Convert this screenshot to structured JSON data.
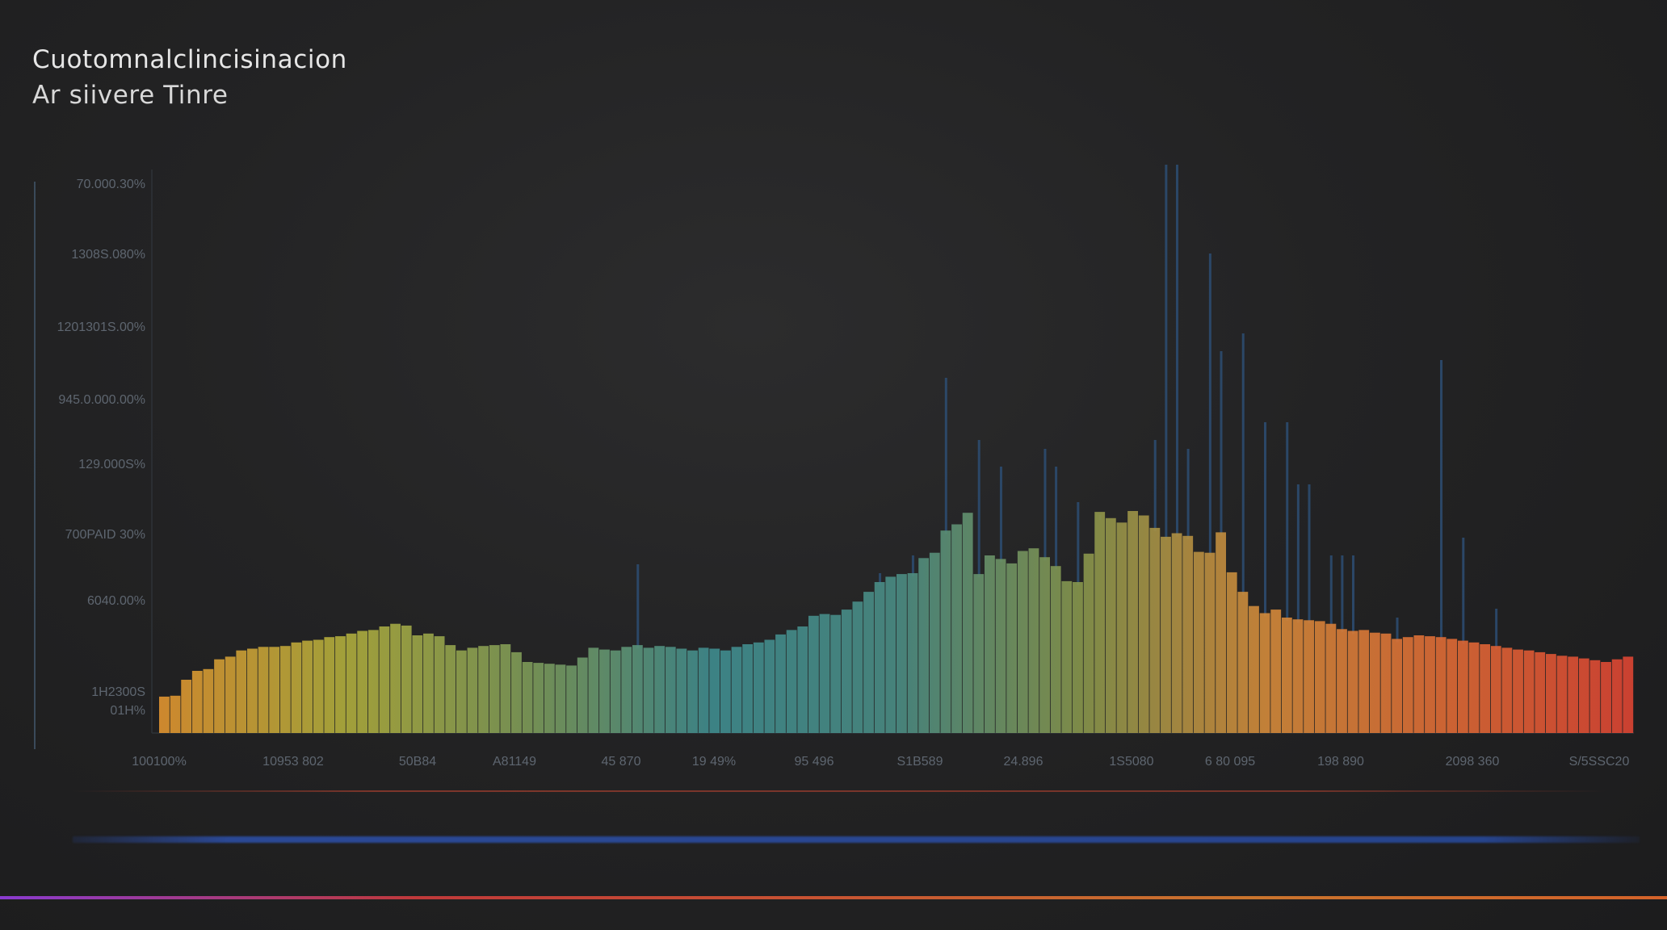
{
  "chart_data": {
    "type": "bar",
    "title": "Cuotomnalclincisinacion",
    "subtitle": "Ar siivere Tinre",
    "xlabel": "",
    "ylabel": "",
    "y_ticks": [
      "70.000.30%",
      "1308S.080%",
      "1201301S.00%",
      "945.0.000.00%",
      "129.000S%",
      "700PAID 30%",
      "6040.00%",
      "1H2300S",
      "01H%"
    ],
    "x_ticks": [
      "100100%",
      "10953 802",
      "50B84",
      "A81149",
      "45 870",
      "19 49%",
      "95 496",
      "S1B589",
      "24.896",
      "1S5080",
      "6 80 095",
      "198 890",
      "2098 360",
      "S/5SSC20"
    ],
    "values": [
      4.1,
      4.2,
      6.0,
      7.0,
      7.2,
      8.3,
      8.6,
      9.3,
      9.5,
      9.7,
      9.7,
      9.8,
      10.2,
      10.4,
      10.5,
      10.8,
      10.9,
      11.2,
      11.5,
      11.6,
      12.0,
      12.3,
      12.1,
      11.0,
      11.2,
      10.9,
      9.9,
      9.3,
      9.6,
      9.8,
      9.9,
      10.0,
      9.1,
      8.0,
      7.9,
      7.8,
      7.7,
      7.6,
      8.5,
      9.6,
      9.4,
      9.3,
      9.7,
      9.9,
      9.6,
      9.8,
      9.7,
      9.5,
      9.3,
      9.6,
      9.5,
      9.3,
      9.7,
      10.0,
      10.2,
      10.5,
      11.1,
      11.6,
      12.0,
      13.2,
      13.4,
      13.3,
      13.9,
      14.8,
      15.9,
      17.0,
      17.6,
      17.9,
      18.0,
      19.7,
      20.3,
      22.8,
      23.5,
      24.8,
      17.9,
      20.0,
      19.6,
      19.1,
      20.5,
      20.8,
      19.8,
      18.8,
      17.1,
      17.0,
      20.2,
      24.9,
      24.2,
      23.7,
      25.0,
      24.5,
      23.1,
      22.1,
      22.5,
      22.2,
      20.4,
      20.3,
      22.6,
      18.1,
      15.9,
      14.3,
      13.5,
      13.9,
      13.0,
      12.8,
      12.7,
      12.6,
      12.3,
      11.7,
      11.5,
      11.6,
      11.3,
      11.2,
      10.6,
      10.8,
      11.0,
      10.9,
      10.8,
      10.6,
      10.4,
      10.2,
      10.0,
      9.8,
      9.6,
      9.4,
      9.3,
      9.1,
      8.9,
      8.7,
      8.6,
      8.4,
      8.2,
      8.0,
      8.3,
      8.6
    ],
    "spikes": [
      {
        "index": 43,
        "value": 19.0
      },
      {
        "index": 65,
        "value": 18.0
      },
      {
        "index": 68,
        "value": 20.0
      },
      {
        "index": 71,
        "value": 40.0
      },
      {
        "index": 74,
        "value": 33.0
      },
      {
        "index": 76,
        "value": 30.0
      },
      {
        "index": 80,
        "value": 32.0
      },
      {
        "index": 81,
        "value": 30.0
      },
      {
        "index": 83,
        "value": 26.0
      },
      {
        "index": 85,
        "value": 24.0
      },
      {
        "index": 90,
        "value": 33.0
      },
      {
        "index": 91,
        "value": 64.0
      },
      {
        "index": 92,
        "value": 64.0
      },
      {
        "index": 93,
        "value": 32.0
      },
      {
        "index": 95,
        "value": 54.0
      },
      {
        "index": 96,
        "value": 43.0
      },
      {
        "index": 98,
        "value": 45.0
      },
      {
        "index": 100,
        "value": 35.0
      },
      {
        "index": 102,
        "value": 35.0
      },
      {
        "index": 103,
        "value": 28.0
      },
      {
        "index": 104,
        "value": 28.0
      },
      {
        "index": 106,
        "value": 20.0
      },
      {
        "index": 107,
        "value": 20.0
      },
      {
        "index": 108,
        "value": 20.0
      },
      {
        "index": 112,
        "value": 13.0
      },
      {
        "index": 116,
        "value": 42.0
      },
      {
        "index": 118,
        "value": 22.0
      },
      {
        "index": 121,
        "value": 14.0
      }
    ],
    "ylim": [
      0,
      80
    ],
    "grid": false,
    "colors": {
      "gradient_stops": [
        "#e0932f",
        "#b0ad3c",
        "#7d9a58",
        "#3f8c8f",
        "#4a8c84",
        "#87964c",
        "#d38a3a",
        "#de6a35",
        "#dd4433"
      ],
      "spike": "#2d4d73",
      "axis": "#3a4a5a",
      "tick_text": "#5e6670"
    }
  }
}
